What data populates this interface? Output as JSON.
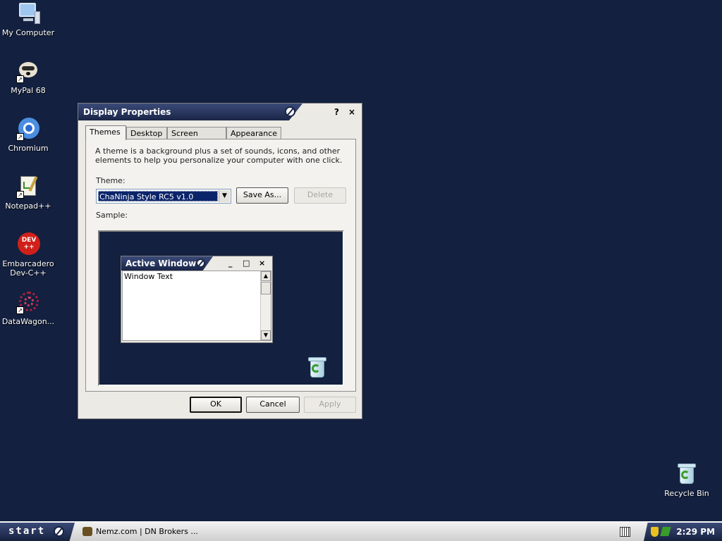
{
  "desktop": {
    "icons": [
      {
        "label": "My Computer"
      },
      {
        "label": "MyPal 68"
      },
      {
        "label": "Chromium"
      },
      {
        "label": "Notepad++"
      },
      {
        "label": "Embarcadero Dev-C++",
        "icon_text": "DEV ++"
      },
      {
        "label": "DataWagon..."
      },
      {
        "label": "Recycle Bin"
      }
    ]
  },
  "dialog": {
    "title": "Display Properties",
    "help_button": "?",
    "close_button": "×",
    "tabs": [
      "Themes",
      "Desktop",
      "Screen Saver",
      "Appearance"
    ],
    "active_tab": "Themes",
    "description": "A theme is a background plus a set of sounds, icons, and other elements to help you personalize your computer with one click.",
    "theme_label": "Theme:",
    "theme_value": "ChaNinja Style RC5 v1.0",
    "save_as_label": "Save As...",
    "delete_label": "Delete",
    "sample_label": "Sample:",
    "sample": {
      "window_title": "Active Window",
      "window_text": "Window Text",
      "min": "_",
      "max": "□",
      "close": "×"
    },
    "ok_label": "OK",
    "cancel_label": "Cancel",
    "apply_label": "Apply"
  },
  "taskbar": {
    "start_label": "start",
    "task_label": "Nemz.com | DN Brokers ...",
    "clock": "2:29 PM"
  },
  "colors": {
    "desktop": "#13203f",
    "titlebar": "#1a2547",
    "selection": "#0a246a"
  }
}
